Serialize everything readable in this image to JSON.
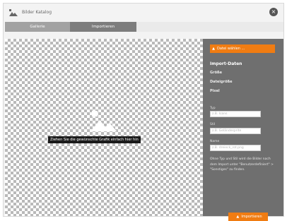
{
  "window": {
    "title": "Bilder Katalog",
    "close_icon": "×"
  },
  "tabs": [
    {
      "label": "Gallerie"
    },
    {
      "label": "Importieren",
      "active": true
    }
  ],
  "canvas": {
    "drop_hint": "Ziehen Sie die gewünschte Grafik einfach hier hin"
  },
  "panel": {
    "choose_file_label": "Datei wählen ...",
    "section_title": "Import-Daten",
    "meta_labels": [
      "Größe",
      "Dateigröße",
      "Pixel"
    ],
    "fields": [
      {
        "label": "Typ",
        "placeholder": "z.B. Icons"
      },
      {
        "label": "Stil",
        "placeholder": "z.B. Geländesprite"
      },
      {
        "label": "Name",
        "placeholder": "z.B. dreieck_rot.png"
      }
    ],
    "hint": "Ohne Typ und Stil wird die Bilder nach dem Import unter \"Benutzerdefiniert\" > \"Sonstiges\" zu finden.",
    "import_label": "Importieren"
  },
  "colors": {
    "accent": "#f07c12",
    "panel": "#6f6f6f",
    "active_tab": "#7d7d7d",
    "inactive_tab": "#a2a2a2"
  },
  "icons": {
    "app": "images-icon",
    "close": "close-icon",
    "upload": "upload-icon",
    "placeholder": "image-icon"
  }
}
